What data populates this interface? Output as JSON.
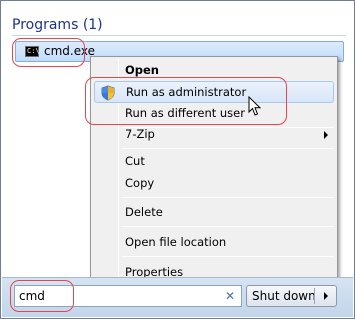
{
  "programs": {
    "header": "Programs (1)",
    "result": {
      "label": "cmd.exe",
      "icon": "cmd-icon",
      "icon_text": "C:\\"
    }
  },
  "context_menu": {
    "items": [
      {
        "label": "Open",
        "bold": true
      },
      {
        "label": "Run as administrator",
        "icon": "uac-shield-icon",
        "highlighted": true
      },
      {
        "label": "Run as different user"
      },
      {
        "label": "7-Zip",
        "submenu": true
      },
      {
        "label": "Cut"
      },
      {
        "label": "Copy"
      },
      {
        "label": "Delete"
      },
      {
        "label": "Open file location"
      },
      {
        "label": "Properties"
      }
    ]
  },
  "search": {
    "value": "cmd",
    "clear_icon": "clear-search-icon",
    "clear_glyph": "✕"
  },
  "shutdown": {
    "label": "Shut down",
    "arrow_icon": "chevron-right-icon"
  },
  "colors": {
    "callout": "#e4474c",
    "section_title": "#1e3287",
    "highlight": "#c2dcfd",
    "menu_bg": "#f0f0f0"
  }
}
